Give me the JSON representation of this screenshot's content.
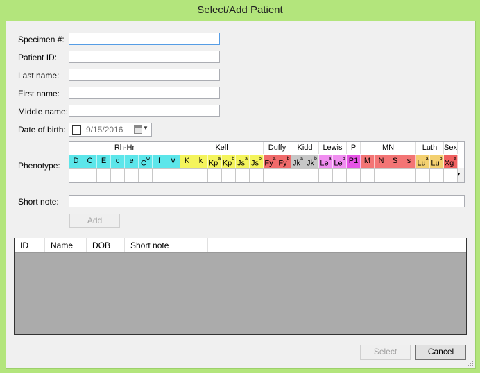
{
  "window": {
    "title": "Select/Add Patient"
  },
  "form": {
    "specimen_label": "Specimen #:",
    "patient_id_label": "Patient ID:",
    "last_name_label": "Last name:",
    "first_name_label": "First name:",
    "middle_name_label": "Middle name:",
    "dob_label": "Date of birth:",
    "dob_value": "9/15/2016",
    "phenotype_label": "Phenotype:",
    "short_note_label": "Short note:",
    "add_button": "Add"
  },
  "phenotype": {
    "groups": [
      "Rh-Hr",
      "Kell",
      "Duffy",
      "Kidd",
      "Lewis",
      "P",
      "MN",
      "Luth",
      "Sex"
    ],
    "antigens": [
      {
        "base": "D",
        "sup": ""
      },
      {
        "base": "C",
        "sup": ""
      },
      {
        "base": "E",
        "sup": ""
      },
      {
        "base": "c",
        "sup": ""
      },
      {
        "base": "e",
        "sup": ""
      },
      {
        "base": "C",
        "sup": "w"
      },
      {
        "base": "f",
        "sup": ""
      },
      {
        "base": "V",
        "sup": ""
      },
      {
        "base": "K",
        "sup": ""
      },
      {
        "base": "k",
        "sup": ""
      },
      {
        "base": "Kp",
        "sup": "a"
      },
      {
        "base": "Kp",
        "sup": "b"
      },
      {
        "base": "Js",
        "sup": "a"
      },
      {
        "base": "Js",
        "sup": "b"
      },
      {
        "base": "Fy",
        "sup": "a"
      },
      {
        "base": "Fy",
        "sup": "b"
      },
      {
        "base": "Jk",
        "sup": "a"
      },
      {
        "base": "Jk",
        "sup": "b"
      },
      {
        "base": "Le",
        "sup": "a"
      },
      {
        "base": "Le",
        "sup": "b"
      },
      {
        "base": "P1",
        "sup": ""
      },
      {
        "base": "M",
        "sup": ""
      },
      {
        "base": "N",
        "sup": ""
      },
      {
        "base": "S",
        "sup": ""
      },
      {
        "base": "s",
        "sup": ""
      },
      {
        "base": "Lu",
        "sup": "a"
      },
      {
        "base": "Lu",
        "sup": "b"
      },
      {
        "base": "Xg",
        "sup": "a"
      }
    ],
    "colors": {
      "Rh-Hr": "#5ce6ea",
      "Kell": "#f4f45c",
      "Duffy": "#f06b6b",
      "Kidd": "#c7c7c7",
      "Lewis": "#f08ef0",
      "P": "#e655e6",
      "MN": "#f37575",
      "Luth": "#f3d070",
      "Sex": "#f06060"
    }
  },
  "results_grid": {
    "columns": [
      "ID",
      "Name",
      "DOB",
      "Short note"
    ]
  },
  "footer": {
    "select_button": "Select",
    "cancel_button": "Cancel"
  }
}
